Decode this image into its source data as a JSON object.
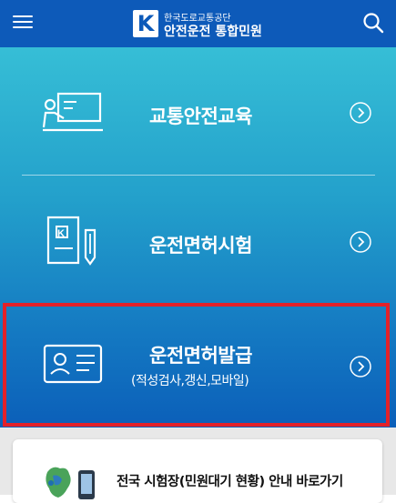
{
  "header": {
    "logo_mark": "K",
    "org_name": "한국도로교통공단",
    "service_name": "안전운전 통합민원",
    "menu_icon": "hamburger-menu-icon",
    "search_icon": "search-icon"
  },
  "menu": [
    {
      "label": "교통안전교육",
      "icon": "lecture-board-icon"
    },
    {
      "label": "운전면허시험",
      "icon": "exam-document-pencil-icon"
    },
    {
      "label": "운전면허발급",
      "sub": "(적성검사,갱신,모바일)",
      "icon": "id-card-icon"
    }
  ],
  "banner": {
    "label": "전국 시험장(민원대기 현황) 안내 바로가기",
    "icon": "korea-map-phone-icon"
  },
  "colors": {
    "header": "#0d5ab9",
    "gradient_top": "#36bed6",
    "gradient_bottom": "#0b5fb9",
    "highlight_border": "#e32129"
  }
}
